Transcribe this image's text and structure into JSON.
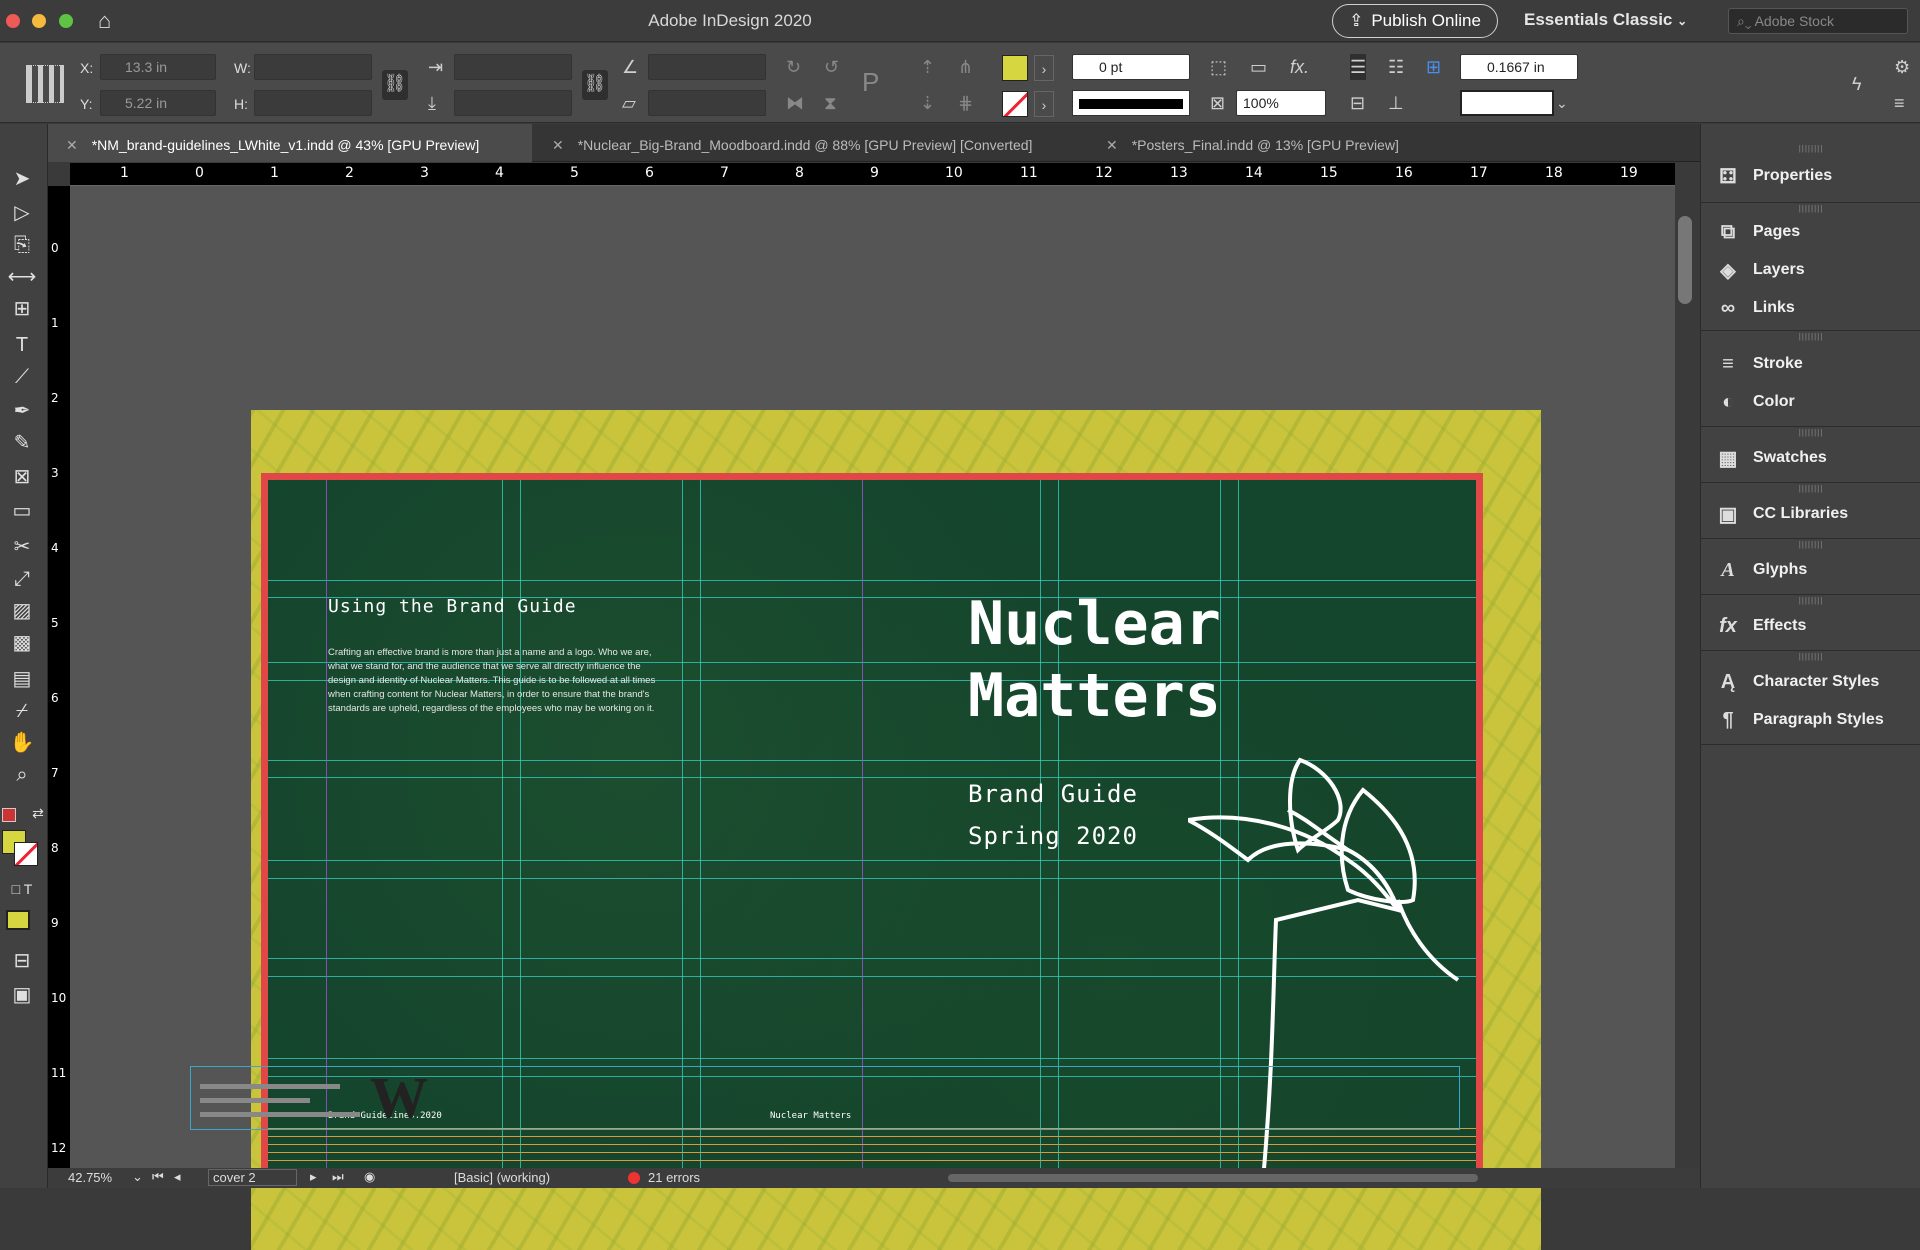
{
  "titlebar": {
    "title": "Adobe InDesign 2020",
    "publish": "Publish Online",
    "workspace": "Essentials Classic",
    "stock_placeholder": "Adobe Stock"
  },
  "control": {
    "x_label": "X:",
    "x_value": "13.3 in",
    "y_label": "Y:",
    "y_value": "5.22 in",
    "w_label": "W:",
    "h_label": "H:",
    "stroke_weight": "0 pt",
    "scale": "100%",
    "gutter": "0.1667 in",
    "fill_color": "#d6d640"
  },
  "tabs": [
    {
      "label": "*NM_brand-guidelines_LWhite_v1.indd @ 43% [GPU Preview]"
    },
    {
      "label": "*Nuclear_Big-Brand_Moodboard.indd @ 88% [GPU Preview] [Converted]"
    },
    {
      "label": "*Posters_Final.indd @ 13% [GPU Preview]"
    }
  ],
  "ruler": {
    "top": [
      "1",
      "0",
      "1",
      "2",
      "3",
      "4",
      "5",
      "6",
      "7",
      "8",
      "9",
      "10",
      "11",
      "12",
      "13",
      "14",
      "15",
      "16",
      "17",
      "18",
      "19"
    ],
    "left": [
      "0",
      "1",
      "2",
      "3",
      "4",
      "5",
      "6",
      "7",
      "8",
      "9",
      "10",
      "11",
      "12"
    ]
  },
  "panels": [
    "Properties",
    "Pages",
    "Layers",
    "Links",
    "Stroke",
    "Color",
    "Swatches",
    "CC Libraries",
    "Glyphs",
    "Effects",
    "Character Styles",
    "Paragraph Styles"
  ],
  "document": {
    "guide_heading": "Using the Brand Guide",
    "guide_body": "Crafting an effective brand is more than just a name and a logo. Who we are, what we stand for, and the audience that we serve all directly influence the design and identity of Nuclear Matters. This guide is to be followed at all times when crafting content for Nuclear Matters, in order to ensure that the brand's standards are upheld, regardless of the employees who may be working on it.",
    "title_line1": "Nuclear",
    "title_line2": "Matters",
    "subtitle1": "Brand Guide",
    "subtitle2": "Spring 2020",
    "footer_left": "Brand Guidelines.2020",
    "footer_right": "Nuclear Matters",
    "colors": {
      "pasteboard": "#555555",
      "spread": "#c9c43c",
      "cover": "#14452d",
      "frame": "#e04848"
    }
  },
  "status": {
    "zoom": "42.75%",
    "page": "cover 2",
    "style": "[Basic] (working)",
    "errors": "21 errors"
  }
}
